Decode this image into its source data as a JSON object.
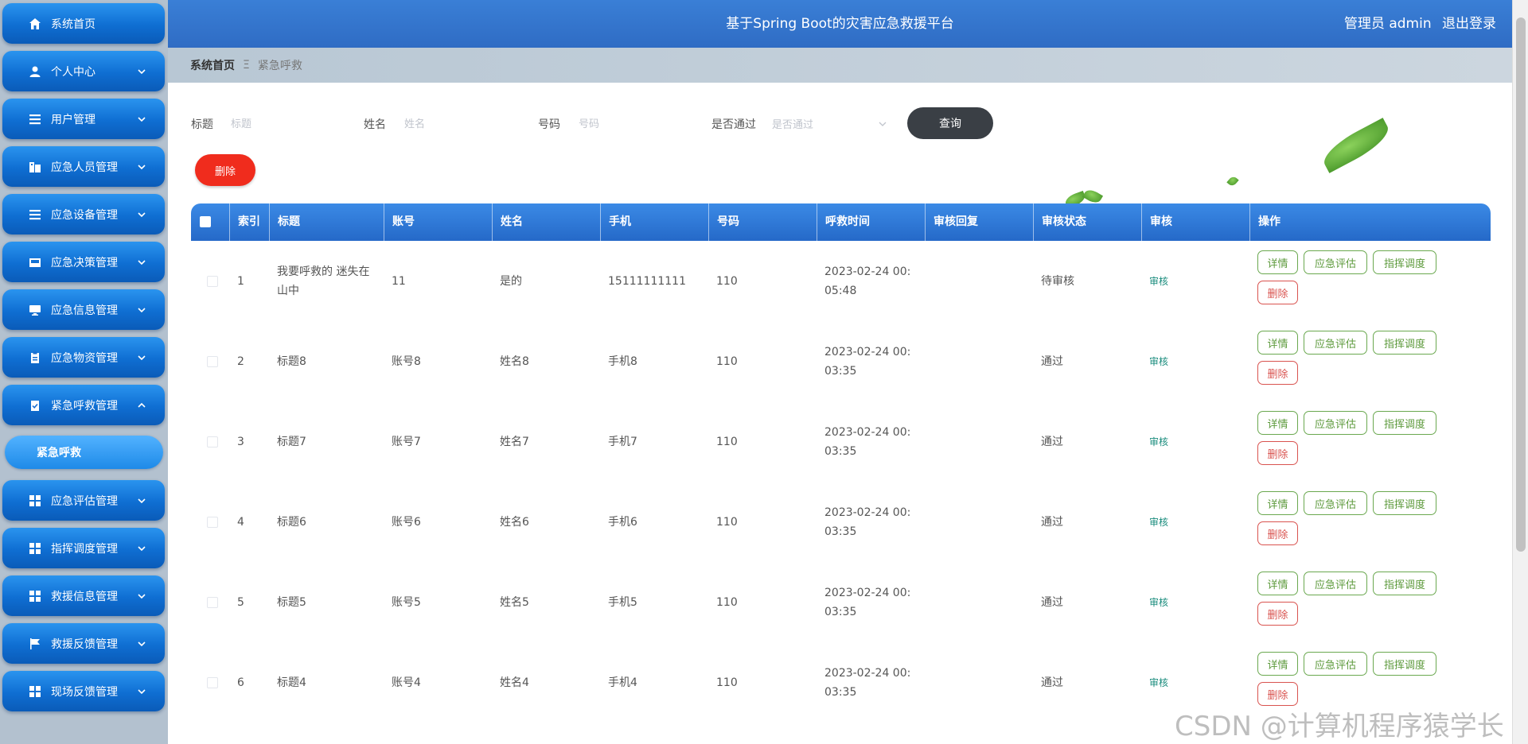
{
  "sidebar": {
    "items": [
      {
        "label": "系统首页",
        "icon": "home-icon",
        "expand": false
      },
      {
        "label": "个人中心",
        "icon": "user-icon",
        "expand": "down"
      },
      {
        "label": "用户管理",
        "icon": "list-icon",
        "expand": "down"
      },
      {
        "label": "应急人员管理",
        "icon": "building-icon",
        "expand": "down"
      },
      {
        "label": "应急设备管理",
        "icon": "list-icon",
        "expand": "down"
      },
      {
        "label": "应急决策管理",
        "icon": "inbox-icon",
        "expand": "down"
      },
      {
        "label": "应急信息管理",
        "icon": "monitor-icon",
        "expand": "down"
      },
      {
        "label": "应急物资管理",
        "icon": "clipboard-icon",
        "expand": "down"
      },
      {
        "label": "紧急呼救管理",
        "icon": "clipboard-check-icon",
        "expand": "up"
      },
      {
        "label": "应急评估管理",
        "icon": "grid-icon",
        "expand": "down"
      },
      {
        "label": "指挥调度管理",
        "icon": "grid-icon",
        "expand": "down"
      },
      {
        "label": "救援信息管理",
        "icon": "grid-icon",
        "expand": "down"
      },
      {
        "label": "救援反馈管理",
        "icon": "flag-icon",
        "expand": "down"
      },
      {
        "label": "现场反馈管理",
        "icon": "grid-icon",
        "expand": "down"
      }
    ],
    "active_sub": "紧急呼救"
  },
  "header": {
    "title": "基于Spring Boot的灾害应急救援平台",
    "user_label": "管理员 admin",
    "logout": "退出登录"
  },
  "breadcrumb": {
    "home": "系统首页",
    "separator": "Ξ",
    "current": "紧急呼救"
  },
  "search": {
    "title_label": "标题",
    "title_placeholder": "标题",
    "name_label": "姓名",
    "name_placeholder": "姓名",
    "number_label": "号码",
    "number_placeholder": "号码",
    "pass_label": "是否通过",
    "pass_placeholder": "是否通过",
    "query_button": "查询",
    "delete_button": "删除"
  },
  "table": {
    "headers": [
      "索引",
      "标题",
      "账号",
      "姓名",
      "手机",
      "号码",
      "呼救时间",
      "审核回复",
      "审核状态",
      "审核",
      "操作"
    ],
    "rows": [
      {
        "index": "1",
        "title": "我要呼救的 迷失在山中",
        "account": "11",
        "name": "是的",
        "phone": "15111111111",
        "number": "110",
        "time": "2023-02-24 00:05:48",
        "reply": "",
        "status": "待审核",
        "audit": "审核"
      },
      {
        "index": "2",
        "title": "标题8",
        "account": "账号8",
        "name": "姓名8",
        "phone": "手机8",
        "number": "110",
        "time": "2023-02-24 00:03:35",
        "reply": "",
        "status": "通过",
        "audit": "审核"
      },
      {
        "index": "3",
        "title": "标题7",
        "account": "账号7",
        "name": "姓名7",
        "phone": "手机7",
        "number": "110",
        "time": "2023-02-24 00:03:35",
        "reply": "",
        "status": "通过",
        "audit": "审核"
      },
      {
        "index": "4",
        "title": "标题6",
        "account": "账号6",
        "name": "姓名6",
        "phone": "手机6",
        "number": "110",
        "time": "2023-02-24 00:03:35",
        "reply": "",
        "status": "通过",
        "audit": "审核"
      },
      {
        "index": "5",
        "title": "标题5",
        "account": "账号5",
        "name": "姓名5",
        "phone": "手机5",
        "number": "110",
        "time": "2023-02-24 00:03:35",
        "reply": "",
        "status": "通过",
        "audit": "审核"
      },
      {
        "index": "6",
        "title": "标题4",
        "account": "账号4",
        "name": "姓名4",
        "phone": "手机4",
        "number": "110",
        "time": "2023-02-24 00:03:35",
        "reply": "",
        "status": "通过",
        "audit": "审核"
      }
    ],
    "actions": {
      "detail": "详情",
      "assess": "应急评估",
      "dispatch": "指挥调度",
      "delete": "删除"
    }
  },
  "watermark": "CSDN @计算机程序猿学长",
  "colors": {
    "header": "#3a7fd6",
    "sidebar_item": "#0f6ed2",
    "delete": "#f02c1d",
    "action_green": "#6aa84f",
    "action_red": "#d9534f"
  }
}
